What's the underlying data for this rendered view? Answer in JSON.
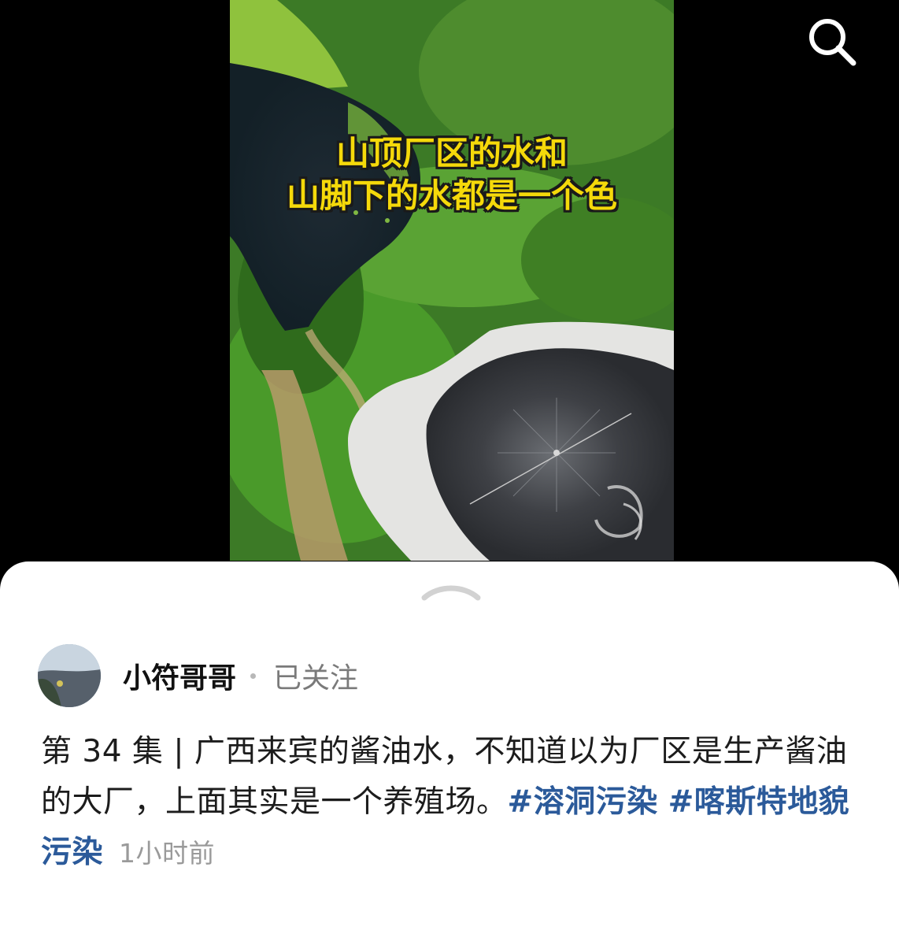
{
  "video": {
    "caption_line1": "山顶厂区的水和",
    "caption_line2": "山脚下的水都是一个色"
  },
  "toolbar": {
    "search_icon": "search-icon"
  },
  "sheet": {
    "expand_icon": "chevron-up-icon"
  },
  "author": {
    "name": "小符哥哥",
    "follow_status": "已关注"
  },
  "post": {
    "text_prefix": "第 34 集 | 广西来宾的酱油水，不知道以为厂区是生产酱油的大厂，上面其实是一个养殖场。",
    "hashtags": [
      "#溶洞污染",
      "#喀斯特地貌污染"
    ],
    "timestamp": "1小时前"
  },
  "colors": {
    "background": "#000000",
    "caption_yellow": "#f5d90a",
    "hashtag_blue": "#2b5a9a",
    "muted_gray": "#9a9a9a"
  }
}
